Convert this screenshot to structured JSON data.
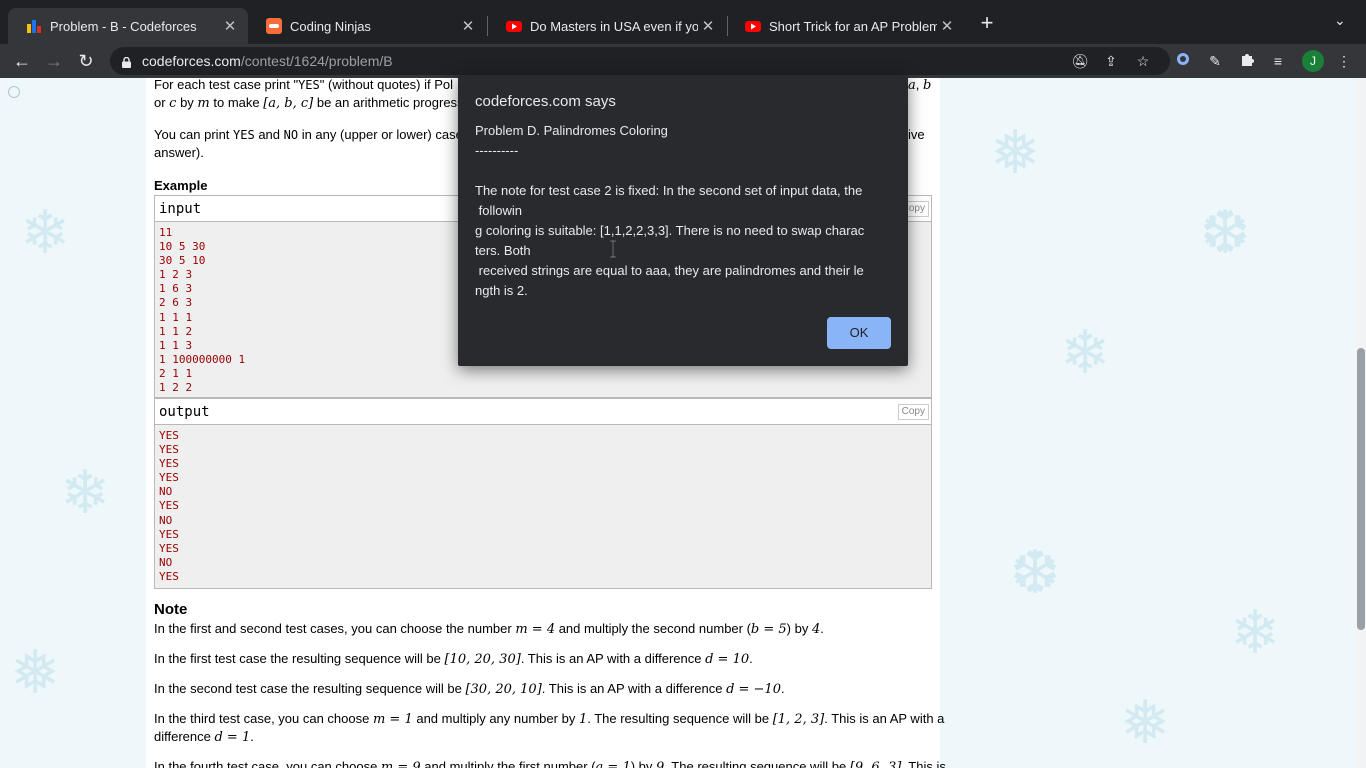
{
  "tabs": [
    {
      "title": "Problem - B - Codeforces",
      "icon": "codeforces-favicon"
    },
    {
      "title": "Coding Ninjas",
      "icon": "coding-ninjas-favicon"
    },
    {
      "title": "Do Masters in USA even if you",
      "icon": "youtube-favicon"
    },
    {
      "title": "Short Trick for an AP Problem -",
      "icon": "youtube-favicon"
    }
  ],
  "omnibox": {
    "host": "codeforces.com",
    "path": "/contest/1624/problem/B"
  },
  "problem": {
    "para1_line1_start": "For each test case print \"",
    "para1_yes": "YES",
    "para1_line1_end": "\" (without quotes) if Pol",
    "para1_right_a": "a",
    "para1_right_b": "b",
    "para1_line2_a": "or ",
    "para1_line2_c": "c",
    "para1_line2_by": " by ",
    "para1_line2_m": "m",
    "para1_line2_make": " to make ",
    "para1_line2_abc": "[a, b, c]",
    "para1_line2_end": " be an arithmetic progressio",
    "para2_start": "You can print ",
    "para2_yes": "YES",
    "para2_and": " and ",
    "para2_no": "NO",
    "para2_end": " in any (upper or lower) case",
    "para2_right": "ive",
    "para2_line2": "answer).",
    "example_heading": "Example",
    "input_title": "input",
    "output_title": "output",
    "copy_label": "Copy",
    "input_lines": "11\n10 5 30\n30 5 10\n1 2 3\n1 6 3\n2 6 3\n1 1 1\n1 1 2\n1 1 3\n1 100000000 1\n2 1 1\n1 2 2",
    "output_lines": "YES\nYES\nYES\nYES\nNO\nYES\nNO\nYES\nYES\nNO\nYES",
    "note_heading": "Note",
    "note1_a": "In the first and second test cases, you can choose the number ",
    "note1_m": "m = 4",
    "note1_b": " and multiply the second number (",
    "note1_eq": "b = 5",
    "note1_c": ") by ",
    "note1_d": "4",
    "note1_e": ".",
    "note2_a": "In the first test case the resulting sequence will be ",
    "note2_seq": "[10, 20, 30]",
    "note2_b": ". This is an AP with a difference ",
    "note2_d": "d = 10",
    "note2_e": ".",
    "note3_a": "In the second test case the resulting sequence will be ",
    "note3_seq": "[30, 20, 10]",
    "note3_b": ". This is an AP with a difference ",
    "note3_d": "d = −10",
    "note3_e": ".",
    "note4_a": "In the third test case, you can choose ",
    "note4_m": "m = 1",
    "note4_b": " and multiply any number by ",
    "note4_one": "1",
    "note4_c": ". The resulting sequence will be ",
    "note4_seq": "[1, 2, 3]",
    "note4_d": ". This is an AP with a",
    "note4_line2": "difference ",
    "note4_dd": "d = 1",
    "note4_e": ".",
    "note5_a": "In the fourth test case, you can choose ",
    "note5_m": "m = 9",
    "note5_b": " and multiply the first number (",
    "note5_eq": "a = 1",
    "note5_c": ") by ",
    "note5_nine": "9",
    "note5_d": ". The resulting sequence will be ",
    "note5_seq": "[9, 6, 3]",
    "note5_e": ". This is"
  },
  "dialog": {
    "title": "codeforces.com says",
    "message": "Problem D. Palindromes Coloring\n----------\n\nThe note for test case 2 is fixed: In the second set of input data, the\n followin\ng coloring is suitable: [1,1,2,2,3,3]. There is no need to swap charac\nters. Both\n received strings are equal to aaa, they are palindromes and their le\nngth is 2.",
    "ok_label": "OK"
  },
  "colors": {
    "chrome_dark": "#202124",
    "chrome_tab": "#35363a",
    "dialog_bg": "#292a2d",
    "ok_button": "#8ab4f8",
    "io_text": "#990000",
    "profile": "#188038"
  }
}
